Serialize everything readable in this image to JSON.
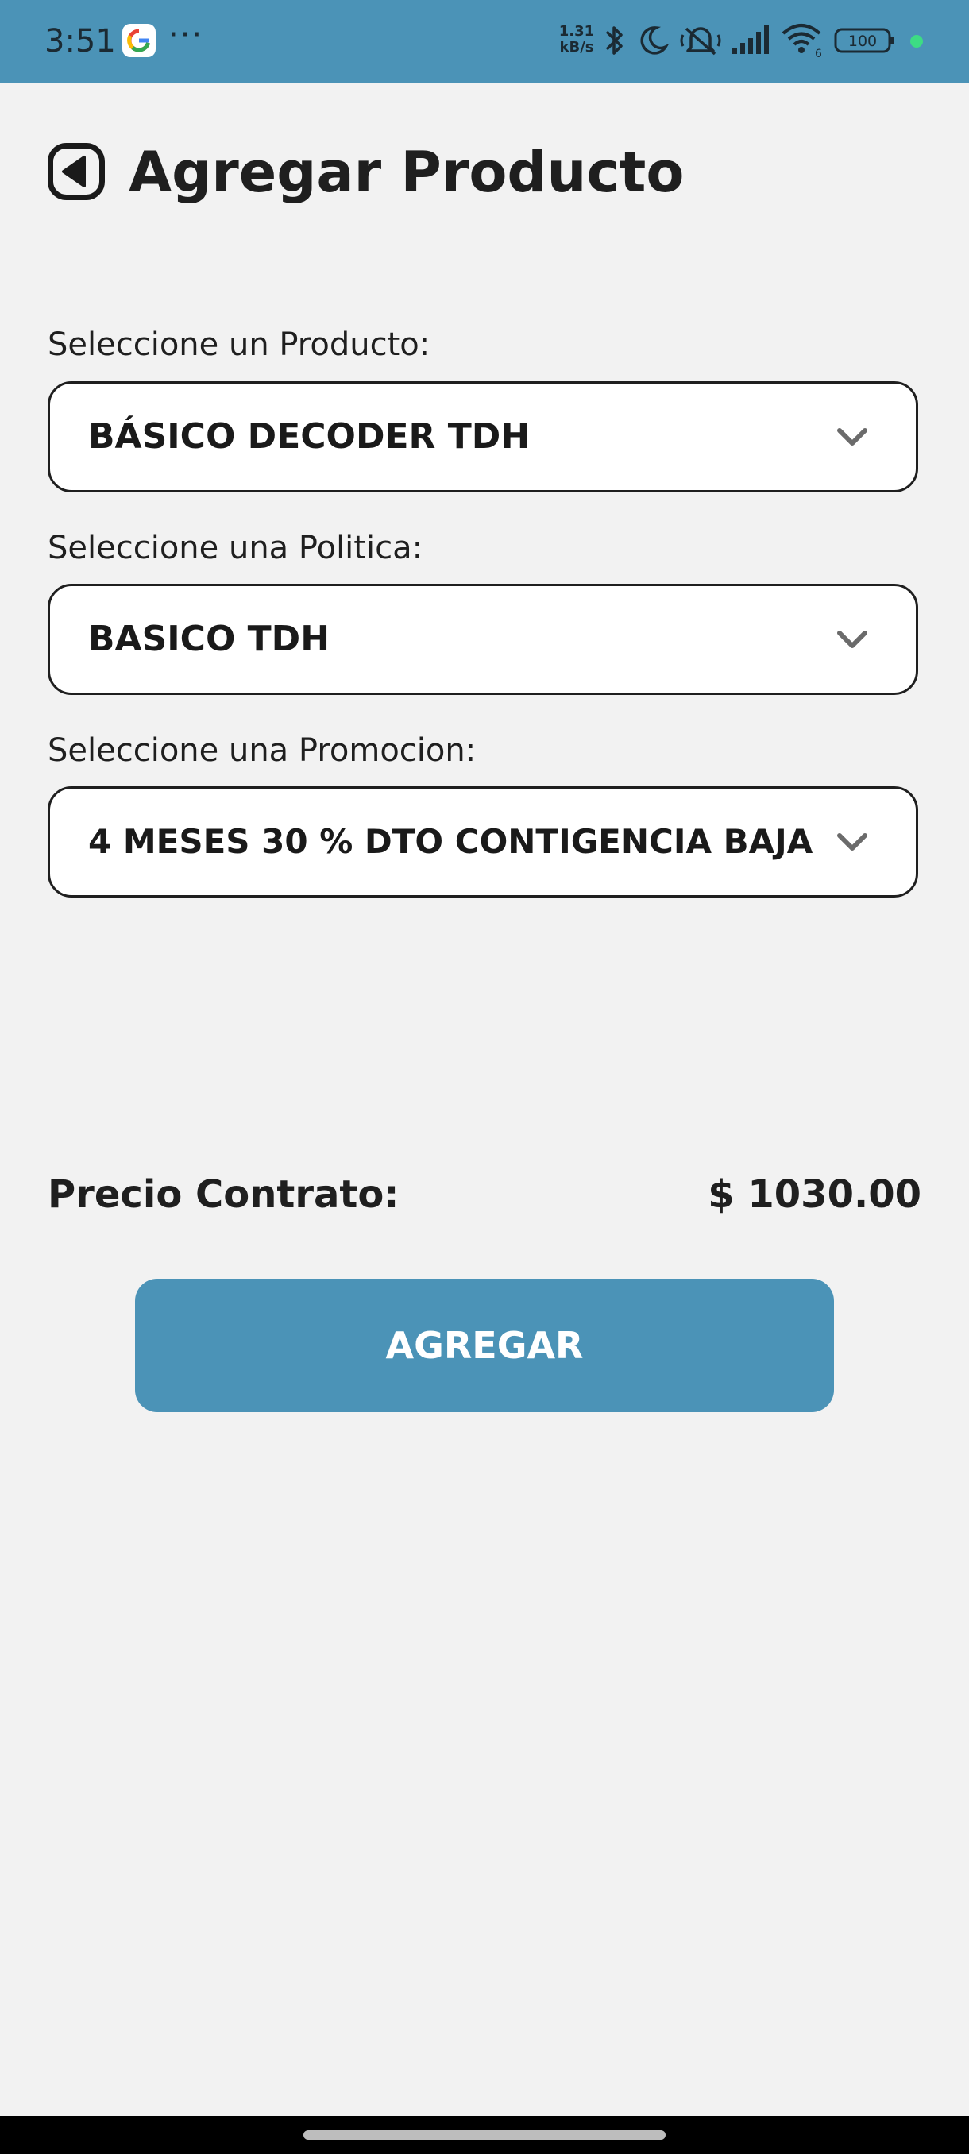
{
  "status_bar": {
    "time": "3:51",
    "overflow": "···",
    "net_speed_value": "1.31",
    "net_speed_unit": "kB/s",
    "battery_level": "100",
    "wifi_label": "6",
    "icons": [
      "google-icon",
      "bluetooth-icon",
      "moon-icon",
      "mute-icon",
      "signal-icon",
      "wifi-icon",
      "battery-icon",
      "status-dot-icon"
    ],
    "colors": {
      "bar": "#4b93b7",
      "status_dot": "#3ddc84"
    }
  },
  "header": {
    "title": "Agregar Producto",
    "back_icon": "back-arrow-icon"
  },
  "form": {
    "product": {
      "label": "Seleccione un Producto:",
      "value": "BÁSICO DECODER TDH"
    },
    "policy": {
      "label": "Seleccione una Politica:",
      "value": "BASICO TDH"
    },
    "promotion": {
      "label": "Seleccione una Promocion:",
      "value": "4 MESES 30 % DTO CONTIGENCIA BAJA"
    }
  },
  "price": {
    "label": "Precio Contrato:",
    "value": "$ 1030.00"
  },
  "actions": {
    "add_label": "AGREGAR"
  },
  "colors": {
    "accent": "#4b93b7",
    "background": "#f2f2f2",
    "text": "#1f1f1f"
  }
}
